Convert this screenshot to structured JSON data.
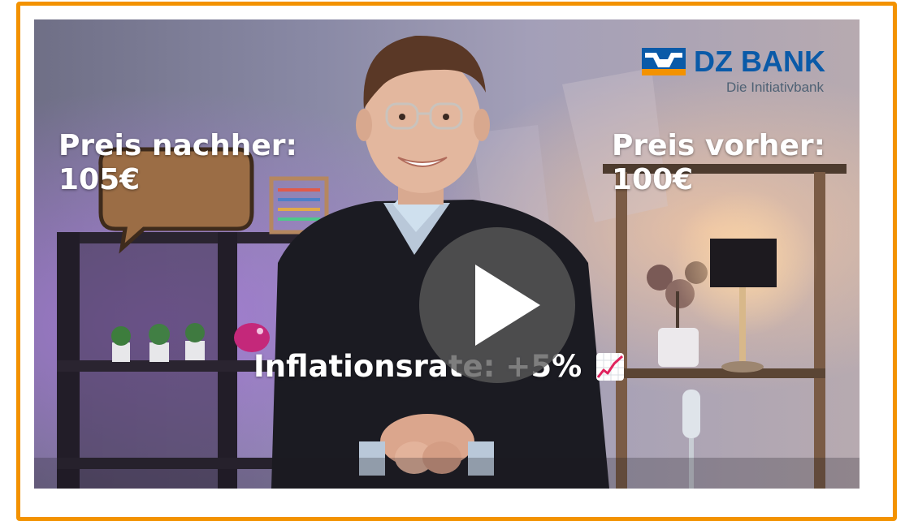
{
  "video": {
    "price_after_label": "Preis nachher:",
    "price_after_value": "105€",
    "price_before_label": "Preis vorher:",
    "price_before_value": "100€",
    "inflation_text": "Inflationsrate: +5%",
    "inflation_icon": "chart-increasing-icon"
  },
  "logo": {
    "name": "DZ BANK",
    "tagline": "Die Initiativbank"
  },
  "colors": {
    "frame_border": "#f39200",
    "logo_blue": "#0a5aa8",
    "play_button": "#5a5a5a"
  }
}
